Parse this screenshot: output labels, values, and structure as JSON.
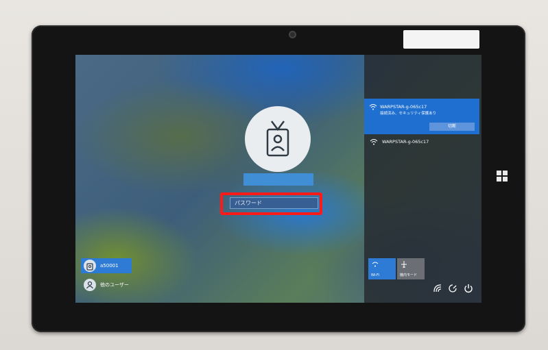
{
  "login": {
    "username": "",
    "password_placeholder": "パスワード"
  },
  "users": {
    "current": "a50001",
    "other": "他のユーザー"
  },
  "network": {
    "connected_ssid": "WARPSTAR-g-065c17",
    "connected_status": "接続済み、セキュリティ保護あり",
    "disconnect_label": "切断",
    "other_ssid": "WARPSTAR-g-065c17"
  },
  "quick_actions": {
    "wifi_label": "Wi-Fi",
    "airplane_label": "機内モード"
  },
  "colors": {
    "accent": "#2e7bd6",
    "highlight": "#ff1a1a"
  }
}
